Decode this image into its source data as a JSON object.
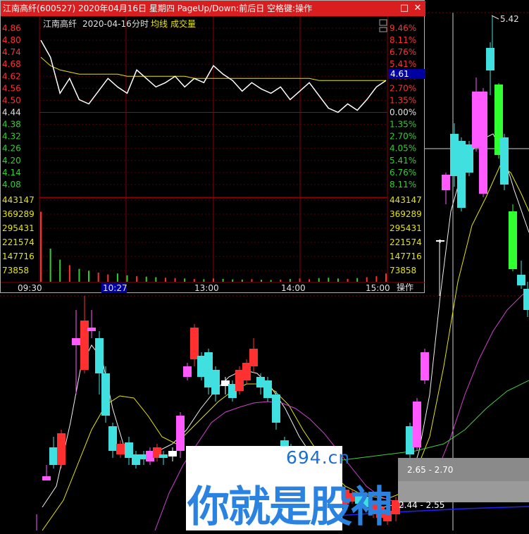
{
  "window": {
    "title": "江南高纤(600527)  2020年04月16日  星期四  PageUp/Down:前后日  空格键:操作",
    "restore_icon": "restore-icon",
    "close_icon": "close-icon"
  },
  "header": {
    "stock_name": "江南高纤",
    "date": "2020-04-16",
    "period": "分时",
    "avg_label": "均线",
    "vol_label": "成交量"
  },
  "price_axis_left": [
    "4.86",
    "4.80",
    "4.74",
    "4.68",
    "4.62",
    "4.56",
    "4.50",
    "4.44",
    "4.38",
    "4.32",
    "4.26",
    "4.20",
    "4.14",
    "4.08"
  ],
  "pct_axis_right": [
    "9.46%",
    "8.11%",
    "6.76%",
    "5.41%",
    "4.05%",
    "2.70%",
    "1.35%",
    "0.00%",
    "1.35%",
    "2.70%",
    "4.05%",
    "5.41%",
    "6.76%",
    "8.11%"
  ],
  "volume_axis": [
    "443147",
    "369289",
    "295431",
    "221574",
    "147716",
    "73858"
  ],
  "time_axis": [
    "09:30",
    "10:27",
    "13:00",
    "14:00",
    "15:00"
  ],
  "current_price_tag": "4.61",
  "operate_label": "操作",
  "colors": {
    "up": "#ff3030",
    "down": "#30d030",
    "accent": "#0000a0",
    "title_bar": "#d81e1e",
    "grid": "#8b0000",
    "avg": "#e6e600"
  },
  "bg_chart": {
    "high_label": "5.42",
    "price_box1": "2.65 - 2.70",
    "price_box2": "2.44 - 2.55"
  },
  "watermark": {
    "domain": "694.cn",
    "slogan": "你就是股神"
  },
  "chart_data": {
    "type": "line",
    "title": "江南高纤",
    "x": [
      "09:30",
      "10:27",
      "13:00",
      "14:00",
      "15:00"
    ],
    "prev_close": 4.44,
    "ylim": [
      4.08,
      4.86
    ],
    "series": [
      {
        "name": "分时",
        "values": [
          4.8,
          4.72,
          4.55,
          4.62,
          4.52,
          4.5,
          4.56,
          4.62,
          4.58,
          4.55,
          4.66,
          4.62,
          4.58,
          4.6,
          4.63,
          4.58,
          4.62,
          4.6,
          4.68,
          4.64,
          4.61,
          4.56,
          4.6,
          4.57,
          4.55,
          4.58,
          4.52,
          4.56,
          4.6,
          4.54,
          4.48,
          4.46,
          4.5,
          4.47,
          4.52,
          4.58,
          4.61
        ]
      },
      {
        "name": "均线",
        "values": [
          4.72,
          4.68,
          4.66,
          4.65,
          4.64,
          4.64,
          4.64,
          4.64,
          4.64,
          4.63,
          4.63,
          4.63,
          4.63,
          4.63,
          4.63,
          4.63,
          4.62,
          4.62,
          4.62,
          4.62,
          4.62,
          4.62,
          4.62,
          4.62,
          4.62,
          4.62,
          4.62,
          4.62,
          4.62,
          4.61,
          4.61,
          4.61,
          4.61,
          4.61,
          4.61,
          4.61,
          4.61
        ]
      }
    ],
    "volume": [
      380000,
      180000,
      120000,
      90000,
      70000,
      60000,
      50000,
      40000,
      45000,
      35000,
      30000,
      28000,
      25000,
      22000,
      20000,
      18000,
      15000,
      14000,
      18000,
      16000,
      13000,
      12000,
      14000,
      11000,
      10000,
      12000,
      15000,
      18000,
      14000,
      20000,
      22000,
      18000,
      16000,
      20000,
      25000,
      30000,
      45000
    ]
  }
}
